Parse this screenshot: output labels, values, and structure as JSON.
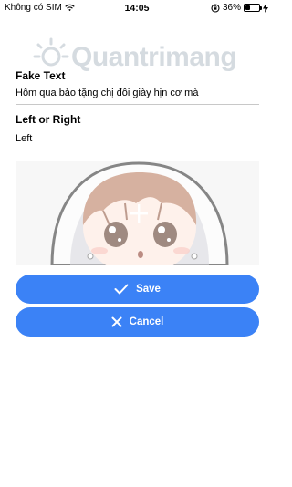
{
  "status": {
    "carrier": "Không có SIM",
    "time": "14:05",
    "battery_percent_text": "36%",
    "battery_level": 0.36
  },
  "watermark": {
    "text": "Quantrimang"
  },
  "form": {
    "fake_text_label": "Fake Text",
    "fake_text_value": "Hôm qua bảo tặng chị đôi giày hịn cơ mà",
    "left_right_label": "Left or Right",
    "left_right_value": "Left"
  },
  "image_picker": {
    "icon": "plus-icon"
  },
  "buttons": {
    "save_label": "Save",
    "save_icon": "checkmark-icon",
    "cancel_label": "Cancel",
    "cancel_icon": "x-icon",
    "color": "#3b82f6"
  }
}
